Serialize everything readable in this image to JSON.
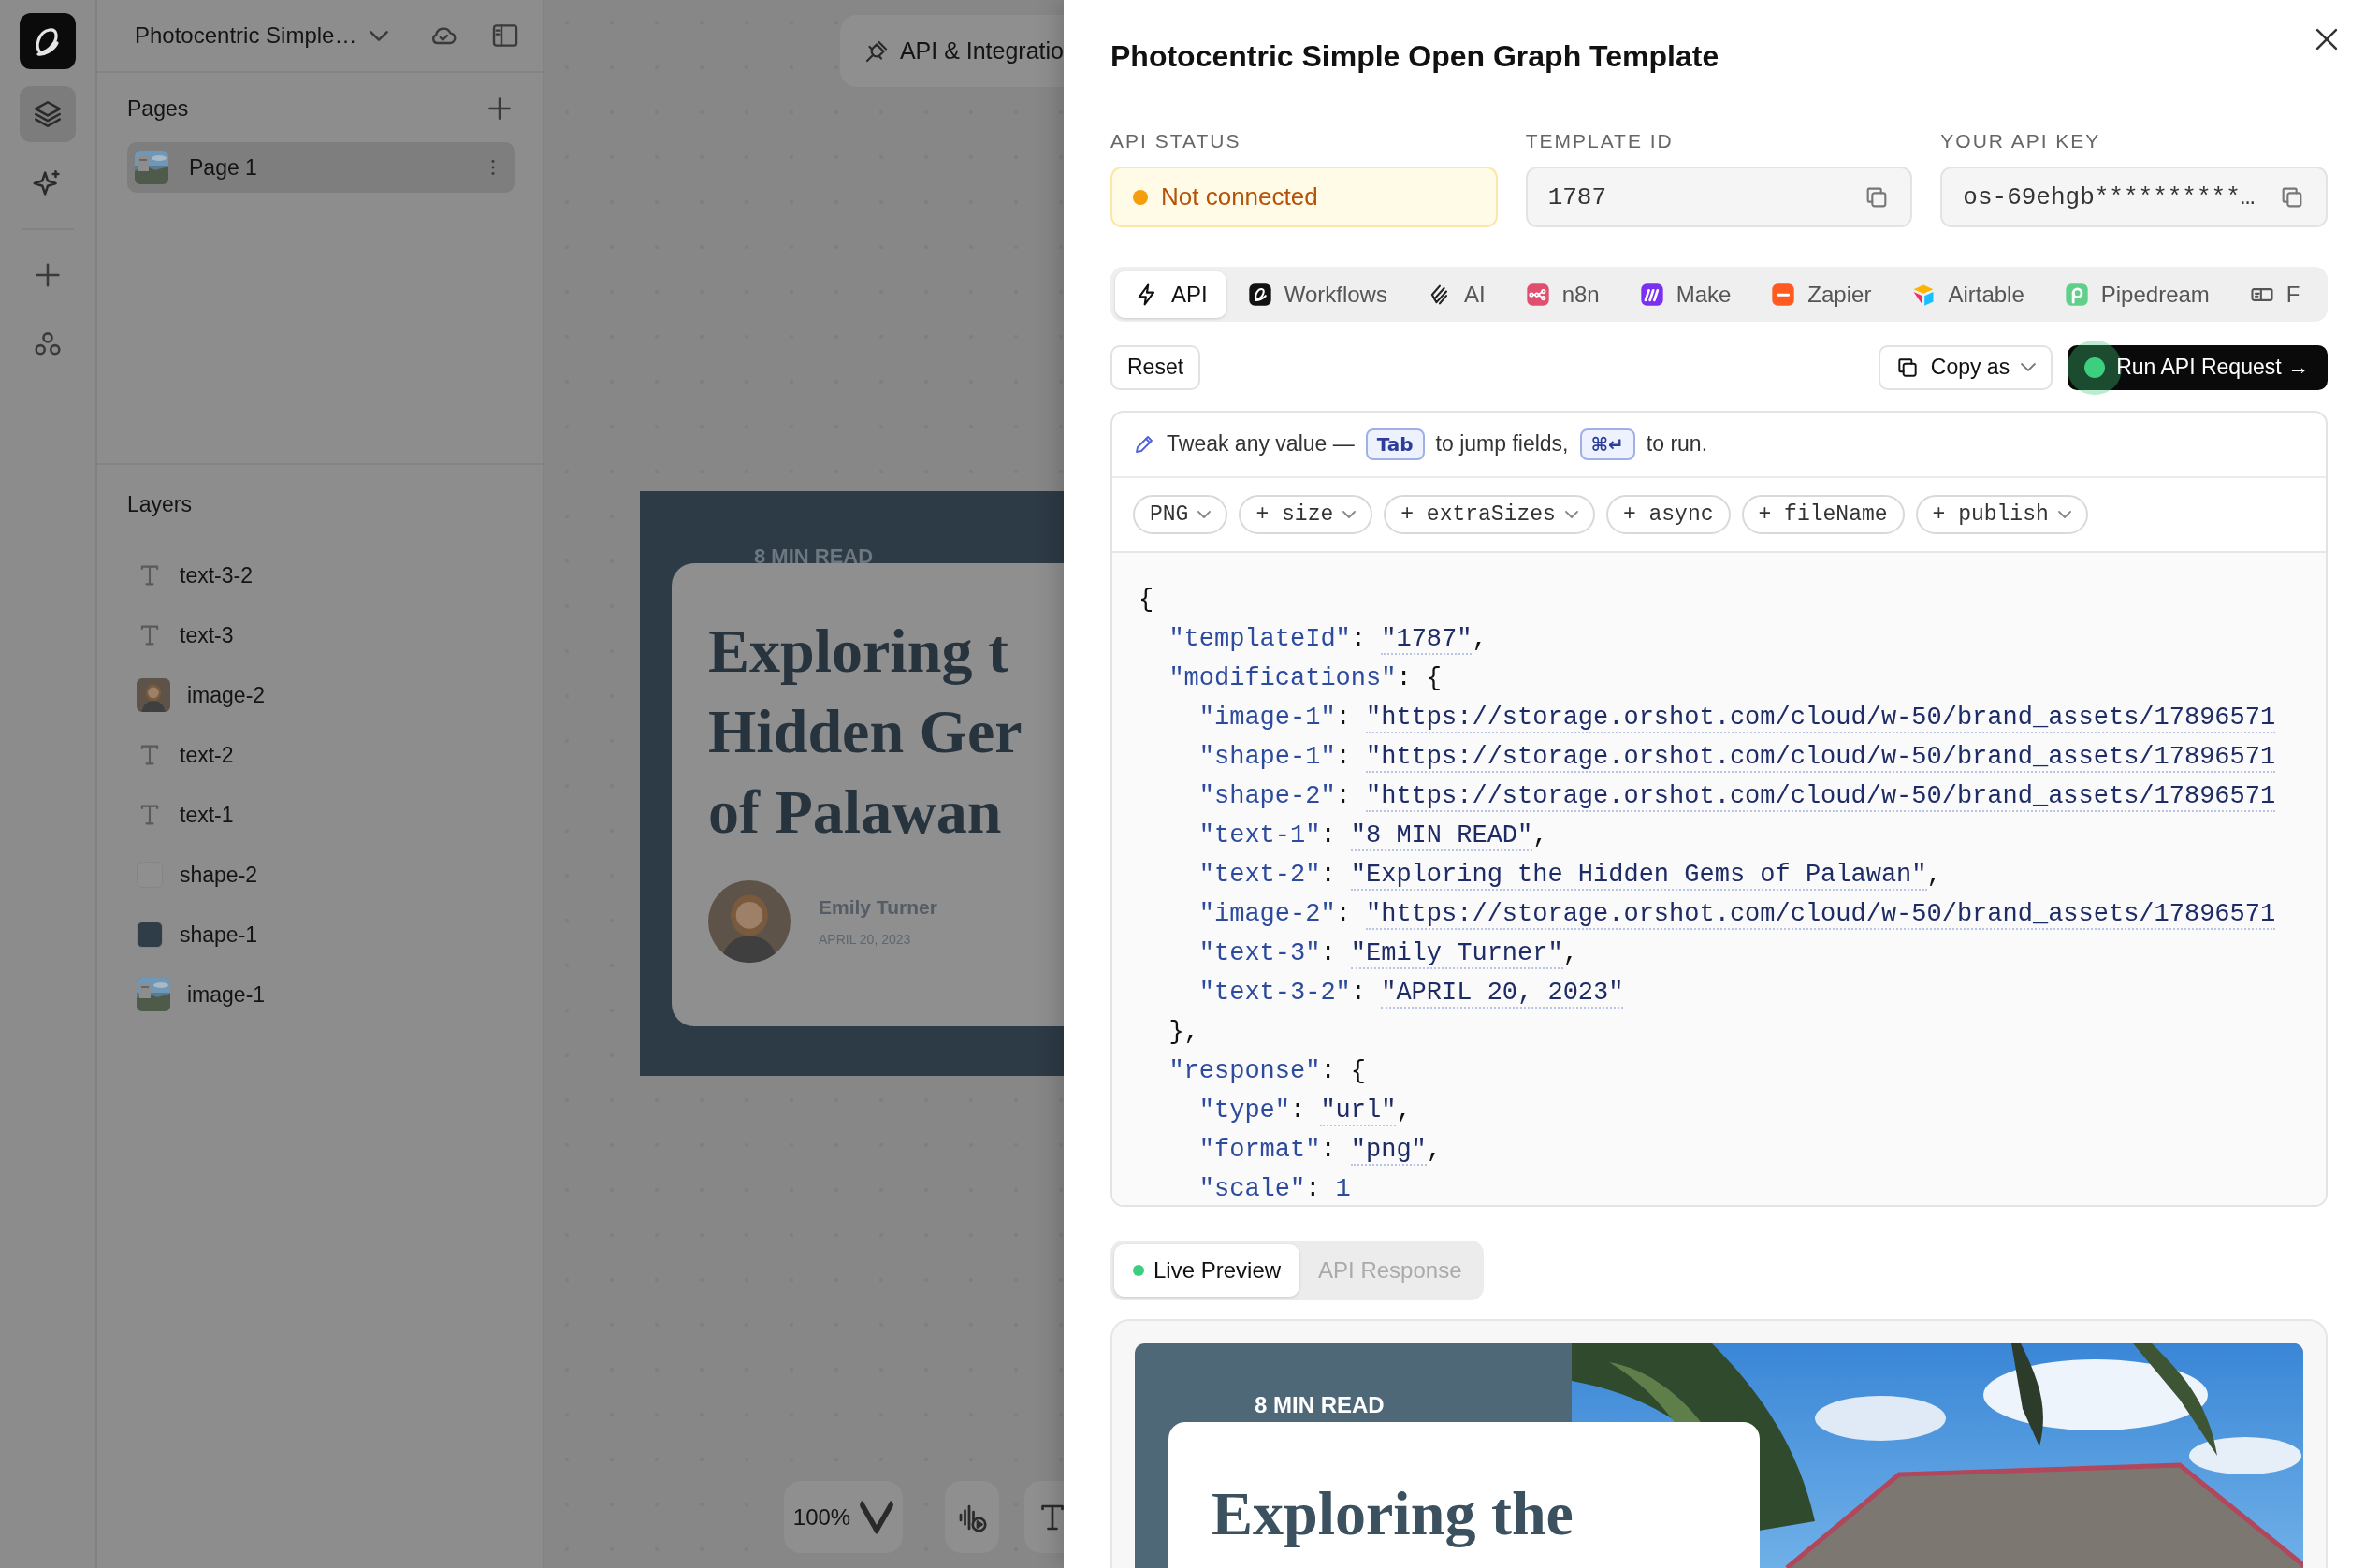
{
  "rail": {
    "tools": [
      {
        "kind": "layers",
        "selected": true
      },
      {
        "kind": "sparkle",
        "selected": false
      }
    ],
    "actions": [
      {
        "kind": "add"
      },
      {
        "kind": "components"
      }
    ]
  },
  "project": {
    "title": "Photocentric Simple…"
  },
  "pages": {
    "heading": "Pages",
    "items": [
      {
        "name": "Page 1",
        "selected": true
      }
    ]
  },
  "layers": {
    "heading": "Layers",
    "items": [
      {
        "kind": "text",
        "name": "text-3-2"
      },
      {
        "kind": "text",
        "name": "text-3"
      },
      {
        "name": "image-2"
      },
      {
        "kind": "text",
        "name": "text-2"
      },
      {
        "kind": "text",
        "name": "text-1"
      },
      {
        "kind": "shape",
        "name": "shape-2",
        "color": "#8f8f8f"
      },
      {
        "kind": "shape",
        "name": "shape-1",
        "color": "#2f3d48"
      },
      {
        "name": "image-1"
      }
    ]
  },
  "canvas": {
    "integration_button": "API & Integratio",
    "artboard": {
      "kicker": "8 MIN READ",
      "title_lines": [
        "Exploring t",
        "Hidden Ger",
        "of Palawan"
      ],
      "author": "Emily Turner",
      "date": "APRIL 20, 2023"
    },
    "zoom": "100%"
  },
  "panel": {
    "title": "Photocentric Simple Open Graph Template",
    "fields": [
      {
        "label": "API STATUS",
        "kind": "status",
        "value": "Not connected",
        "connected": false
      },
      {
        "label": "TEMPLATE ID",
        "kind": "copy",
        "value": "1787"
      },
      {
        "label": "YOUR API KEY",
        "kind": "copy",
        "value": "os-69ehgb**********…"
      }
    ],
    "tabs": [
      {
        "label": "API",
        "kind": "bolt",
        "selected": true
      },
      {
        "label": "Workflows",
        "kind": "workflows",
        "selected": false
      },
      {
        "label": "AI",
        "kind": "ai",
        "selected": false
      },
      {
        "label": "n8n",
        "kind": "n8n",
        "color": "#e0506e",
        "selected": false
      },
      {
        "label": "Make",
        "kind": "make",
        "color": "#7b2ff0",
        "selected": false
      },
      {
        "label": "Zapier",
        "kind": "zapier",
        "color": "#ff5a1f",
        "selected": false
      },
      {
        "label": "Airtable",
        "kind": "airtable",
        "selected": false
      },
      {
        "label": "Pipedream",
        "kind": "pipedream",
        "color": "#5fcf8a",
        "selected": false
      },
      {
        "label": "F",
        "kind": "card",
        "selected": false
      }
    ],
    "actions": {
      "reset": "Reset",
      "copy": "Copy as",
      "run": "Run API Request →"
    },
    "hint": {
      "before": "Tweak any value —",
      "key1": "Tab",
      "middle": "to jump fields,",
      "key2": "⌘↵",
      "after": "to run."
    },
    "chips": [
      {
        "label": "PNG",
        "menu": true
      },
      {
        "label": "+ size",
        "menu": true
      },
      {
        "label": "+ extraSizes",
        "menu": true
      },
      {
        "label": "+ async",
        "menu": false
      },
      {
        "label": "+ fileName",
        "menu": false
      },
      {
        "label": "+ publish",
        "menu": true
      }
    ],
    "code": [
      {
        "tokens": [
          {
            "kind": "punct",
            "text": "{"
          }
        ],
        "children": [
          {
            "tokens": [
              {
                "kind": "key",
                "text": "\"templateId\""
              },
              {
                "kind": "punct",
                "text": ": "
              },
              {
                "kind": "str",
                "text": "\"1787\""
              },
              {
                "kind": "punct",
                "text": ","
              }
            ]
          },
          {
            "tokens": [
              {
                "kind": "key",
                "text": "\"modifications\""
              },
              {
                "kind": "punct",
                "text": ": {"
              }
            ],
            "children": [
              {
                "tokens": [
                  {
                    "kind": "key",
                    "text": "\"image-1\""
                  },
                  {
                    "kind": "punct",
                    "text": ": "
                  },
                  {
                    "kind": "str",
                    "text": "\"https://storage.orshot.com/cloud/w-50/brand_assets/17896571"
                  }
                ]
              },
              {
                "tokens": [
                  {
                    "kind": "key",
                    "text": "\"shape-1\""
                  },
                  {
                    "kind": "punct",
                    "text": ": "
                  },
                  {
                    "kind": "str",
                    "text": "\"https://storage.orshot.com/cloud/w-50/brand_assets/17896571"
                  }
                ]
              },
              {
                "tokens": [
                  {
                    "kind": "key",
                    "text": "\"shape-2\""
                  },
                  {
                    "kind": "punct",
                    "text": ": "
                  },
                  {
                    "kind": "str",
                    "text": "\"https://storage.orshot.com/cloud/w-50/brand_assets/17896571"
                  }
                ]
              },
              {
                "tokens": [
                  {
                    "kind": "key",
                    "text": "\"text-1\""
                  },
                  {
                    "kind": "punct",
                    "text": ": "
                  },
                  {
                    "kind": "str",
                    "text": "\"8 MIN READ\""
                  },
                  {
                    "kind": "punct",
                    "text": ","
                  }
                ]
              },
              {
                "tokens": [
                  {
                    "kind": "key",
                    "text": "\"text-2\""
                  },
                  {
                    "kind": "punct",
                    "text": ": "
                  },
                  {
                    "kind": "str",
                    "text": "\"Exploring the Hidden Gems of Palawan\""
                  },
                  {
                    "kind": "punct",
                    "text": ","
                  }
                ]
              },
              {
                "tokens": [
                  {
                    "kind": "key",
                    "text": "\"image-2\""
                  },
                  {
                    "kind": "punct",
                    "text": ": "
                  },
                  {
                    "kind": "str",
                    "text": "\"https://storage.orshot.com/cloud/w-50/brand_assets/17896571"
                  }
                ]
              },
              {
                "tokens": [
                  {
                    "kind": "key",
                    "text": "\"text-3\""
                  },
                  {
                    "kind": "punct",
                    "text": ": "
                  },
                  {
                    "kind": "str",
                    "text": "\"Emily Turner\""
                  },
                  {
                    "kind": "punct",
                    "text": ","
                  }
                ]
              },
              {
                "tokens": [
                  {
                    "kind": "key",
                    "text": "\"text-3-2\""
                  },
                  {
                    "kind": "punct",
                    "text": ": "
                  },
                  {
                    "kind": "str",
                    "text": "\"APRIL 20, 2023\""
                  }
                ]
              }
            ]
          },
          {
            "tokens": [
              {
                "kind": "punct",
                "text": "},"
              }
            ]
          },
          {
            "tokens": [
              {
                "kind": "key",
                "text": "\"response\""
              },
              {
                "kind": "punct",
                "text": ": {"
              }
            ],
            "children": [
              {
                "tokens": [
                  {
                    "kind": "key",
                    "text": "\"type\""
                  },
                  {
                    "kind": "punct",
                    "text": ": "
                  },
                  {
                    "kind": "str",
                    "text": "\"url\""
                  },
                  {
                    "kind": "punct",
                    "text": ","
                  }
                ]
              },
              {
                "tokens": [
                  {
                    "kind": "key",
                    "text": "\"format\""
                  },
                  {
                    "kind": "punct",
                    "text": ": "
                  },
                  {
                    "kind": "str",
                    "text": "\"png\""
                  },
                  {
                    "kind": "punct",
                    "text": ","
                  }
                ]
              },
              {
                "tokens": [
                  {
                    "kind": "key",
                    "text": "\"scale\""
                  },
                  {
                    "kind": "punct",
                    "text": ": "
                  },
                  {
                    "kind": "num",
                    "text": "1"
                  }
                ]
              }
            ]
          }
        ]
      }
    ],
    "preview_tabs": [
      {
        "label": "Live Preview",
        "selected": true,
        "live": true
      },
      {
        "label": "API Response",
        "selected": false,
        "live": false
      }
    ],
    "preview": {
      "kicker": "8 MIN READ",
      "title": "Exploring the"
    }
  }
}
